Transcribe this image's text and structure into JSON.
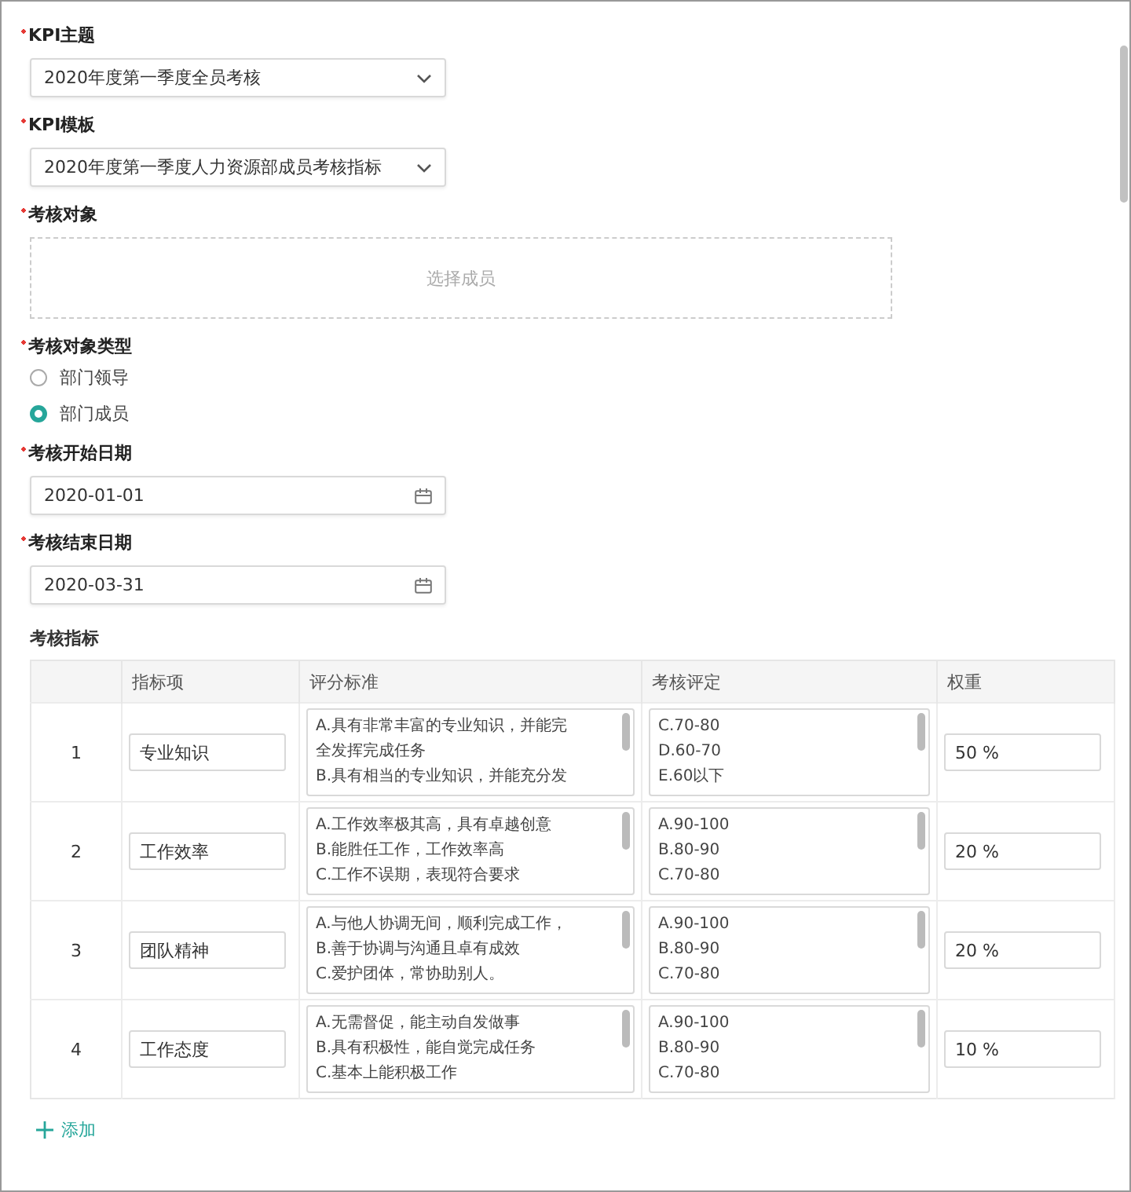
{
  "fields": [
    {
      "kind": "select",
      "label": "KPI主题",
      "required": true,
      "value": "2020年度第一季度全员考核"
    },
    {
      "kind": "select",
      "label": "KPI模板",
      "required": true,
      "value": "2020年度第一季度人力资源部成员考核指标"
    },
    {
      "kind": "picker",
      "label": "考核对象",
      "required": true,
      "placeholder": "选择成员"
    },
    {
      "kind": "radio",
      "label": "考核对象类型",
      "required": true,
      "options": [
        {
          "label": "部门领导",
          "selected": false
        },
        {
          "label": "部门成员",
          "selected": true
        }
      ]
    },
    {
      "kind": "date",
      "label": "考核开始日期",
      "required": true,
      "value": "2020-01-01"
    },
    {
      "kind": "date",
      "label": "考核结束日期",
      "required": true,
      "value": "2020-03-31"
    }
  ],
  "indicators": {
    "label": "考核指标",
    "columns": [
      "指标项",
      "评分标准",
      "考核评定",
      "权重"
    ],
    "rows": [
      {
        "index": "1",
        "name": "专业知识",
        "criteria": [
          "A.具有非常丰富的专业知识，并能完",
          "全发挥完成任务",
          "B.具有相当的专业知识，并能充分发"
        ],
        "rating": [
          "C.70-80",
          "D.60-70",
          "E.60以下"
        ],
        "weight": "50 %"
      },
      {
        "index": "2",
        "name": "工作效率",
        "criteria": [
          "A.工作效率极其高，具有卓越创意",
          "B.能胜任工作，工作效率高",
          "C.工作不误期，表现符合要求"
        ],
        "rating": [
          "A.90-100",
          "B.80-90",
          "C.70-80"
        ],
        "weight": "20 %"
      },
      {
        "index": "3",
        "name": "团队精神",
        "criteria": [
          "A.与他人协调无间，顺利完成工作，",
          "B.善于协调与沟通且卓有成效",
          "C.爱护团体，常协助别人。"
        ],
        "rating": [
          "A.90-100",
          "B.80-90",
          "C.70-80"
        ],
        "weight": "20 %"
      },
      {
        "index": "4",
        "name": "工作态度",
        "criteria": [
          "A.无需督促，能主动自发做事",
          "B.具有积极性，能自觉完成任务",
          "C.基本上能积极工作"
        ],
        "rating": [
          "A.90-100",
          "B.80-90",
          "C.70-80"
        ],
        "weight": "10 %"
      }
    ],
    "add_label": "添加"
  }
}
